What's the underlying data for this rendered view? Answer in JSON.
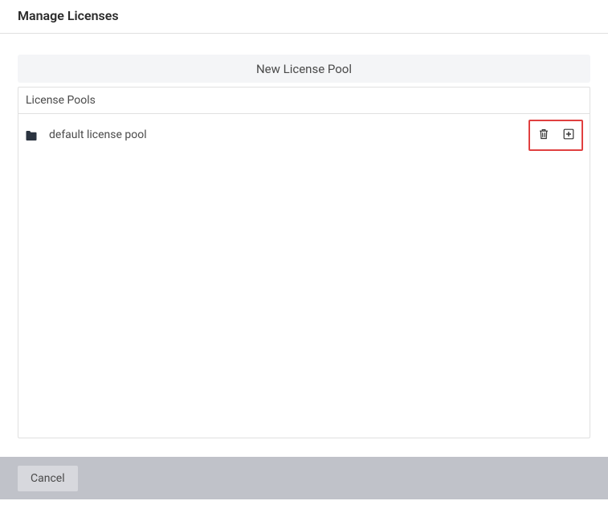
{
  "header": {
    "title": "Manage Licenses"
  },
  "actions": {
    "new_pool_label": "New License Pool"
  },
  "panel": {
    "title": "License Pools",
    "pools": [
      {
        "name": "default license pool"
      }
    ]
  },
  "footer": {
    "cancel_label": "Cancel"
  }
}
